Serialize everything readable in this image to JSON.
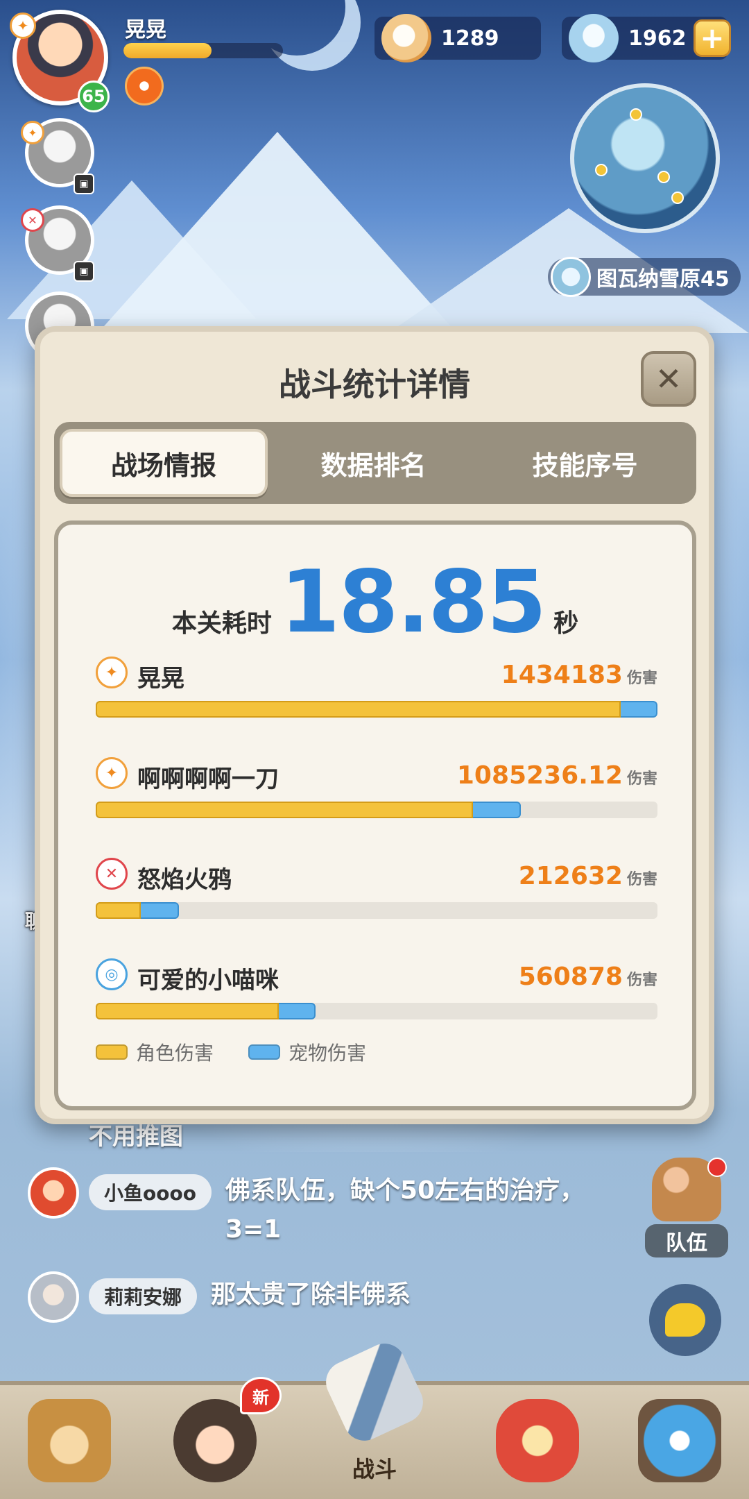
{
  "player": {
    "name": "晃晃",
    "level": "65",
    "hp_fraction": 0.55
  },
  "currency": {
    "pearls": "1289",
    "gems": "1962",
    "add_symbol": "+"
  },
  "map": {
    "location": "图瓦纳雪原45"
  },
  "stats_modal": {
    "title": "战斗统计详情",
    "close_symbol": "✕",
    "tabs": [
      {
        "label": "战场情报",
        "active": true
      },
      {
        "label": "数据排名",
        "active": false
      },
      {
        "label": "技能序号",
        "active": false
      }
    ],
    "time": {
      "label": "本关耗时",
      "value": "18.85",
      "unit": "秒"
    },
    "damage_unit": "伤害",
    "members": [
      {
        "name": "晃晃",
        "damage": "1434183",
        "total_fraction": 1.0,
        "char_fraction": 0.935,
        "icon_color": "#f1a03b"
      },
      {
        "name": "啊啊啊啊一刀",
        "damage": "1085236.12",
        "total_fraction": 0.757,
        "char_fraction": 0.672,
        "icon_color": "#f1a03b"
      },
      {
        "name": "怒焰火鸦",
        "damage": "212632",
        "total_fraction": 0.148,
        "char_fraction": 0.08,
        "icon_color": "#e0464c"
      },
      {
        "name": "可爱的小喵咪",
        "damage": "560878",
        "total_fraction": 0.391,
        "char_fraction": 0.326,
        "icon_color": "#4aa3df"
      }
    ],
    "legend": [
      {
        "label": "角色伤害",
        "color": "#f4c23b"
      },
      {
        "label": "宠物伤害",
        "color": "#5fb3ee"
      }
    ]
  },
  "chat": {
    "button_label": "聊天",
    "previous_message": "不用推图",
    "messages": [
      {
        "name": "小鱼oooo",
        "text": "佛系队伍，缺个50左右的治疗，3=1"
      },
      {
        "name": "莉莉安娜",
        "text": "那太贵了除非佛系"
      }
    ]
  },
  "team_button_label": "队伍",
  "nav": {
    "new_badge": "新",
    "items": [
      {
        "label": "",
        "icon": "tribe-icon"
      },
      {
        "label": "",
        "icon": "hero-icon"
      },
      {
        "label": "战斗",
        "icon": "battle-sword-icon"
      },
      {
        "label": "",
        "icon": "pet-icon"
      },
      {
        "label": "",
        "icon": "portal-icon"
      }
    ]
  }
}
